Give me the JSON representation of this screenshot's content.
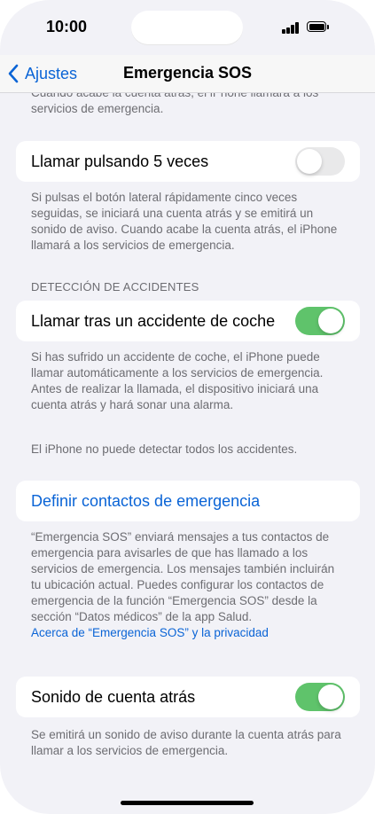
{
  "status_bar": {
    "time": "10:00",
    "signal_icon": "cellular-signal-icon",
    "battery_icon": "battery-full-icon"
  },
  "nav": {
    "back_label": "Ajustes",
    "title": "Emergencia SOS"
  },
  "sections": {
    "top_footnote": "Cuando acabe la cuenta atrás, el iPhone llamará a los servicios de emergencia.",
    "five_presses": {
      "label": "Llamar pulsando 5 veces",
      "toggle_on": false,
      "footnote": "Si pulsas el botón lateral rápidamente cinco veces seguidas, se iniciará una cuenta atrás y se emitirá un sonido de aviso. Cuando acabe la cuenta atrás, el iPhone llamará a los servicios de emergencia."
    },
    "crash_detection": {
      "header": "DETECCIÓN DE ACCIDENTES",
      "label": "Llamar tras un accidente de coche",
      "toggle_on": true,
      "footnote_1": "Si has sufrido un accidente de coche, el iPhone puede llamar automáticamente a los servicios de emergencia. Antes de realizar la llamada, el dispositivo iniciará una cuenta atrás y hará sonar una alarma.",
      "footnote_2": "El iPhone no puede detectar todos los accidentes."
    },
    "emergency_contacts": {
      "link_label": "Definir contactos de emergencia",
      "footnote": "“Emergencia SOS” enviará mensajes a tus contactos de emergencia para avisarles de que has llamado a los servicios de emergencia. Los mensajes también incluirán tu ubicación actual. Puedes configurar los contactos de emergencia de la función “Emergencia SOS” desde la sección “Datos médicos” de la app Salud.",
      "privacy_link": "Acerca de “Emergencia SOS” y la privacidad"
    },
    "countdown_sound": {
      "label": "Sonido de cuenta atrás",
      "toggle_on": true,
      "footnote": "Se emitirá un sonido de aviso durante la cuenta atrás para llamar a los servicios de emergencia."
    }
  },
  "colors": {
    "accent": "#0a64d6",
    "toggle_on": "#5fc36b",
    "toggle_off": "#e9e9ea",
    "background": "#f2f2f7"
  }
}
